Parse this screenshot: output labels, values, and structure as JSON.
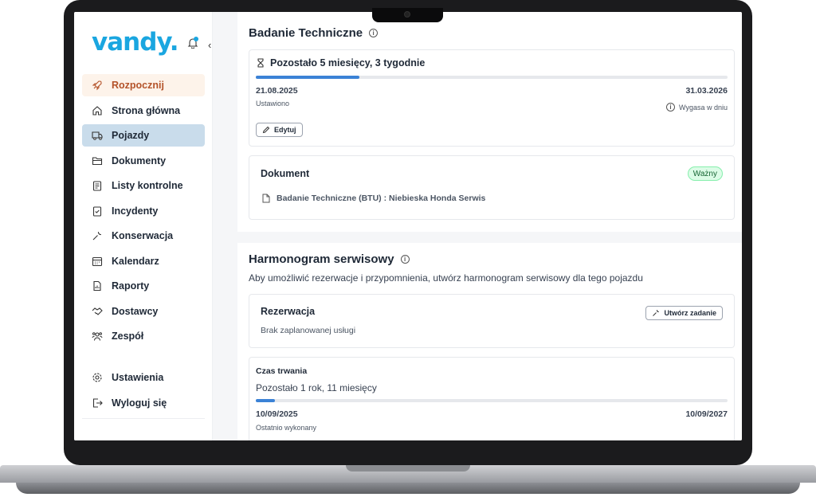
{
  "app": {
    "logo": "vandy."
  },
  "sidebar": {
    "items": [
      {
        "label": "Rozpocznij",
        "icon": "rocket-icon"
      },
      {
        "label": "Strona główna",
        "icon": "home-icon"
      },
      {
        "label": "Pojazdy",
        "icon": "truck-icon"
      },
      {
        "label": "Dokumenty",
        "icon": "folder-icon"
      },
      {
        "label": "Listy kontrolne",
        "icon": "checklist-icon"
      },
      {
        "label": "Incydenty",
        "icon": "clipboard-check-icon"
      },
      {
        "label": "Konserwacja",
        "icon": "wrench-icon"
      },
      {
        "label": "Kalendarz",
        "icon": "calendar-icon"
      },
      {
        "label": "Raporty",
        "icon": "report-icon"
      },
      {
        "label": "Dostawcy",
        "icon": "handshake-icon"
      },
      {
        "label": "Zespół",
        "icon": "team-icon"
      }
    ],
    "bottom": [
      {
        "label": "Ustawienia",
        "icon": "gear-icon"
      },
      {
        "label": "Wyloguj się",
        "icon": "logout-icon"
      }
    ]
  },
  "inspection": {
    "title": "Badanie Techniczne",
    "remaining": "Pozostało 5 miesięcy, 3 tygodnie",
    "progress": 0.22,
    "start_date": "21.08.2025",
    "start_label": "Ustawiono",
    "end_date": "31.03.2026",
    "end_label": "Wygasa w dniu",
    "edit_label": "Edytuj",
    "document": {
      "heading": "Dokument",
      "status": "Ważny",
      "file": "Badanie Techniczne (BTU) : Niebieska Honda Serwis"
    }
  },
  "schedule": {
    "title": "Harmonogram serwisowy",
    "subtitle": "Aby umożliwić rezerwacje i przypomnienia, utwórz harmonogram serwisowy dla tego pojazdu",
    "booking": {
      "heading": "Rezerwacja",
      "empty": "Brak zaplanowanej usługi",
      "create_label": "Utwórz zadanie"
    },
    "duration": {
      "heading": "Czas trwania",
      "remaining": "Pozostało 1 rok, 11 miesięcy",
      "progress": 0.04,
      "start_date": "10/09/2025",
      "start_label": "Ostatnio wykonany",
      "end_date": "10/09/2027"
    }
  }
}
